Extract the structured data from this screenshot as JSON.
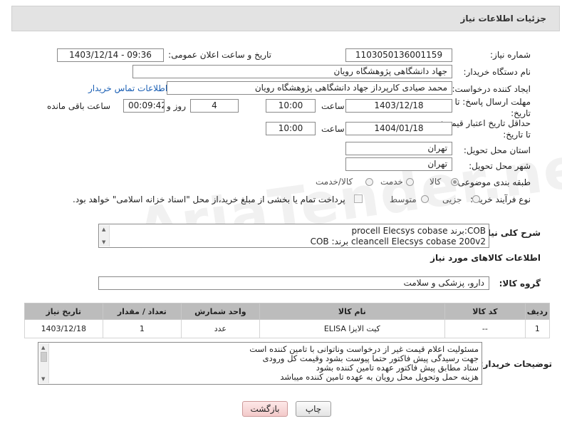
{
  "header": {
    "title": "جزئیات اطلاعات نیاز"
  },
  "fields": {
    "need_number_label": "شماره نیاز:",
    "need_number": "1103050136001159",
    "announce_label": "تاریخ و ساعت اعلان عمومی:",
    "announce_value": "1403/12/14 - 09:36",
    "buyer_org_label": "نام دستگاه خریدار:",
    "buyer_org": "جهاد دانشگاهی پژوهشگاه رویان",
    "creator_label": "ایجاد کننده درخواست:",
    "creator": "محمد صیادی کارپرداز جهاد دانشگاهی پژوهشگاه رویان",
    "contact_link": "اطلاعات تماس خریدار",
    "reply_deadline_label": "مهلت ارسال پاسخ: تا تاریخ:",
    "reply_date": "1403/12/18",
    "time_label": "ساعت",
    "reply_time": "10:00",
    "days_value": "4",
    "days_label": "روز و",
    "remaining_time": "00:09:42",
    "remaining_label": "ساعت باقی مانده",
    "validity_label": "حداقل تاریخ اعتبار قیمت: تا تاریخ:",
    "validity_date": "1404/01/18",
    "validity_time": "10:00",
    "province_label": "استان محل تحویل:",
    "province": "تهران",
    "city_label": "شهر محل تحویل:",
    "city": "تهران",
    "category_label": "طبقه بندی موضوعی:",
    "cat_goods": "کالا",
    "cat_service": "خدمت",
    "cat_goods_service": "کالا/خدمت",
    "process_label": "نوع فرآیند خرید :",
    "proc_minor": "جزیی",
    "proc_medium": "متوسط",
    "payment_note": "پرداخت تمام یا بخشی از مبلغ خرید،از محل \"اسناد خزانه اسلامی\" خواهد بود."
  },
  "description": {
    "label": "شرح کلی نیاز:",
    "line1": "COB:برند procell Elecsys cobase",
    "line2": "cleancell Elecsys cobase 200v2    برند: COB"
  },
  "goods_info": {
    "title": "اطلاعات کالاهای مورد نیاز",
    "group_label": "گروه کالا:",
    "group_value": "دارو، پزشکی و سلامت"
  },
  "table": {
    "headers": [
      "ردیف",
      "کد کالا",
      "نام کالا",
      "واحد شمارش",
      "تعداد / مقدار",
      "تاریخ نیاز"
    ],
    "rows": [
      [
        "1",
        "--",
        "کیت الایزا ELISA",
        "عدد",
        "1",
        "1403/12/18"
      ]
    ]
  },
  "buyer_notes": {
    "label": "توضیحات خریدار:",
    "lines": [
      "مسئولیت اعلام قیمت  غیر از درخواست وناتوانی با تامین کننده است",
      "جهت رسیدگی پیش فاکتور حتما پیوست بشود وقیمت کل ورودی",
      "ستاد مطابق پیش فاکتور عهده تامین کننده بشود",
      "هزینه حمل وتحویل محل رویان به عهده تامین کننده میباشد"
    ]
  },
  "buttons": {
    "print": "چاپ",
    "back": "بازگشت"
  },
  "watermark": "AriaTender.neT"
}
